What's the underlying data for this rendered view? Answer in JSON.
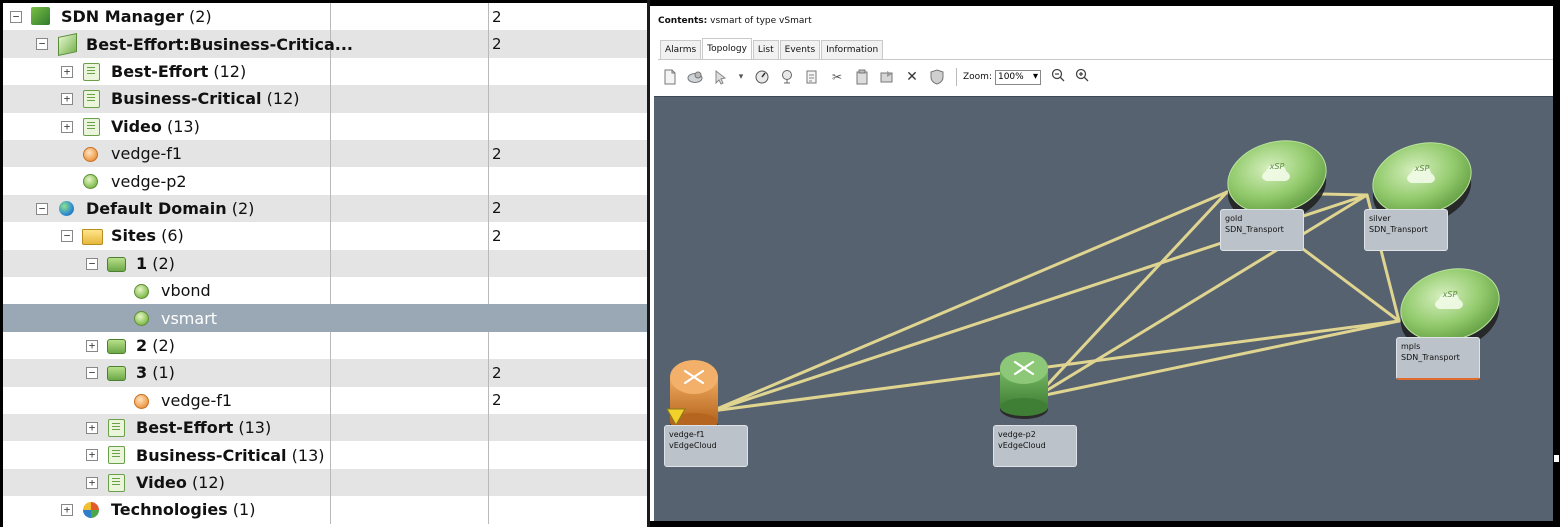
{
  "tree": {
    "rows": [
      {
        "name": "SDN Manager",
        "count": "(2)",
        "col3": "2"
      },
      {
        "name": "Best-Effort:Business-Critica...",
        "count": "",
        "col3": "2"
      },
      {
        "name": "Best-Effort",
        "count": "(12)",
        "col3": ""
      },
      {
        "name": "Business-Critical",
        "count": "(12)",
        "col3": ""
      },
      {
        "name": "Video",
        "count": "(13)",
        "col3": ""
      },
      {
        "name": "vedge-f1",
        "count": "",
        "col3": "2"
      },
      {
        "name": "vedge-p2",
        "count": "",
        "col3": ""
      },
      {
        "name": "Default Domain",
        "count": "(2)",
        "col3": "2"
      },
      {
        "name": "Sites",
        "count": "(6)",
        "col3": "2"
      },
      {
        "name": "1",
        "count": "(2)",
        "col3": ""
      },
      {
        "name": "vbond",
        "count": "",
        "col3": ""
      },
      {
        "name": "vsmart",
        "count": "",
        "col3": ""
      },
      {
        "name": "2",
        "count": "(2)",
        "col3": ""
      },
      {
        "name": "3",
        "count": "(1)",
        "col3": "2"
      },
      {
        "name": "vedge-f1",
        "count": "",
        "col3": "2"
      },
      {
        "name": "Best-Effort",
        "count": "(13)",
        "col3": ""
      },
      {
        "name": "Business-Critical",
        "count": "(13)",
        "col3": ""
      },
      {
        "name": "Video",
        "count": "(12)",
        "col3": ""
      },
      {
        "name": "Technologies",
        "count": "(1)",
        "col3": ""
      }
    ]
  },
  "panel": {
    "contents_label": "Contents:",
    "contents_value": "vsmart of type vSmart",
    "tabs": [
      "Alarms",
      "Topology",
      "List",
      "Events",
      "Information"
    ],
    "active_tab": "Topology",
    "zoom_label": "Zoom:",
    "zoom_value": "100%"
  },
  "topology": {
    "nodes": {
      "gold": {
        "name": "gold",
        "type": "SDN_Transport",
        "icon_text": "xSP"
      },
      "silver": {
        "name": "silver",
        "type": "SDN_Transport",
        "icon_text": "xSP"
      },
      "mpls": {
        "name": "mpls",
        "type": "SDN_Transport",
        "icon_text": "xSP"
      },
      "vedge_f1": {
        "name": "vedge-f1",
        "type": "vEdgeCloud"
      },
      "vedge_p2": {
        "name": "vedge-p2",
        "type": "vEdgeCloud"
      }
    }
  },
  "colors": {
    "canvas_bg": "#566270",
    "link": "#e8dc92",
    "transport_green": "#8cc76a",
    "router_orange": "#d98536",
    "router_green": "#4f9a45",
    "selected_row": "#9aa7b4"
  }
}
